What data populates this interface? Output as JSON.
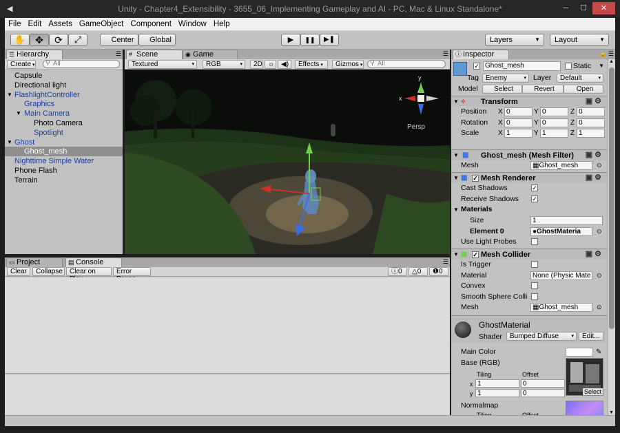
{
  "window": {
    "title": "Unity - Chapter4_Extensibility - 3655_06_Implementing Gameplay and AI - PC, Mac & Linux Standalone*",
    "minimize": "─",
    "maximize": "☐",
    "close": "✕"
  },
  "menu": [
    "File",
    "Edit",
    "Assets",
    "GameObject",
    "Component",
    "Window",
    "Help"
  ],
  "toolbar": {
    "tools": [
      "✋",
      "✥",
      "⟳",
      "⤢"
    ],
    "pivot": "Center",
    "space": "Global",
    "play": "▶",
    "pause": "❚❚",
    "step": "▶❚",
    "layers": "Layers",
    "layout": "Layout"
  },
  "hierarchy": {
    "tab": "Hierarchy",
    "create": "Create",
    "search_placeholder": "All",
    "items": [
      {
        "label": "Capsule",
        "indent": 0,
        "color": "#000000",
        "fold": ""
      },
      {
        "label": "Directional light",
        "indent": 0,
        "color": "#000000",
        "fold": ""
      },
      {
        "label": "FlashlightController",
        "indent": 0,
        "color": "#1a3f9e",
        "fold": "▼"
      },
      {
        "label": "Graphics",
        "indent": 1,
        "color": "#1a3f9e",
        "fold": ""
      },
      {
        "label": "Main Camera",
        "indent": 1,
        "color": "#1a3f9e",
        "fold": "▼"
      },
      {
        "label": "Photo Camera",
        "indent": 2,
        "color": "#000000",
        "fold": ""
      },
      {
        "label": "Spotlight",
        "indent": 2,
        "color": "#1a3f9e",
        "fold": ""
      },
      {
        "label": "Ghost",
        "indent": 0,
        "color": "#1a3f9e",
        "fold": "▼"
      },
      {
        "label": "Ghost_mesh",
        "indent": 1,
        "color": "#ffffff",
        "fold": "",
        "selected": true
      },
      {
        "label": "Nighttime Simple Water",
        "indent": 0,
        "color": "#1a3f9e",
        "fold": ""
      },
      {
        "label": "Phone Flash",
        "indent": 0,
        "color": "#000000",
        "fold": ""
      },
      {
        "label": "Terrain",
        "indent": 0,
        "color": "#000000",
        "fold": ""
      }
    ]
  },
  "scene": {
    "tab_scene": "Scene",
    "tab_game": "Game",
    "render_mode": "Textured",
    "color_mode": "RGB",
    "mode_2d": "2D",
    "effects": "Effects",
    "gizmos": "Gizmos",
    "search_placeholder": "All",
    "persp": "Persp",
    "gizmo_x": "x",
    "gizmo_y": "y"
  },
  "console": {
    "tab_project": "Project",
    "tab_console": "Console",
    "clear": "Clear",
    "collapse": "Collapse",
    "clear_on_play": "Clear on Play",
    "error_pause": "Error Pause",
    "count_info": "0",
    "count_warn": "0",
    "count_error": "0"
  },
  "inspector": {
    "tab": "Inspector",
    "object_name": "Ghost_mesh",
    "static_label": "Static",
    "tag_label": "Tag",
    "tag_value": "Enemy",
    "layer_label": "Layer",
    "layer_value": "Default",
    "model_label": "Model",
    "model_select": "Select",
    "model_revert": "Revert",
    "model_open": "Open",
    "transform": {
      "title": "Transform",
      "position": {
        "label": "Position",
        "x": "0",
        "y": "0",
        "z": "0"
      },
      "rotation": {
        "label": "Rotation",
        "x": "0",
        "y": "0",
        "z": "0"
      },
      "scale": {
        "label": "Scale",
        "x": "1",
        "y": "1",
        "z": "1"
      }
    },
    "mesh_filter": {
      "title": "Ghost_mesh (Mesh Filter)",
      "mesh_label": "Mesh",
      "mesh_value": "Ghost_mesh"
    },
    "mesh_renderer": {
      "title": "Mesh Renderer",
      "cast_shadows": "Cast Shadows",
      "receive_shadows": "Receive Shadows",
      "materials": "Materials",
      "size_label": "Size",
      "size_value": "1",
      "element0_label": "Element 0",
      "element0_value": "GhostMateria",
      "light_probes": "Use Light Probes"
    },
    "mesh_collider": {
      "title": "Mesh Collider",
      "is_trigger": "Is Trigger",
      "material_label": "Material",
      "material_value": "None (Physic Mate",
      "convex": "Convex",
      "smooth": "Smooth Sphere Colli",
      "mesh_label": "Mesh",
      "mesh_value": "Ghost_mesh"
    },
    "material": {
      "name": "GhostMaterial",
      "shader_label": "Shader",
      "shader_value": "Bumped Diffuse",
      "edit": "Edit...",
      "main_color": "Main Color",
      "base": "Base (RGB)",
      "tiling": "Tiling",
      "offset": "Offset",
      "tile_x": "1",
      "tile_y": "1",
      "off_x": "0",
      "off_y": "0",
      "select": "Select",
      "normalmap": "Normalmap",
      "x": "x",
      "y": "y"
    }
  }
}
